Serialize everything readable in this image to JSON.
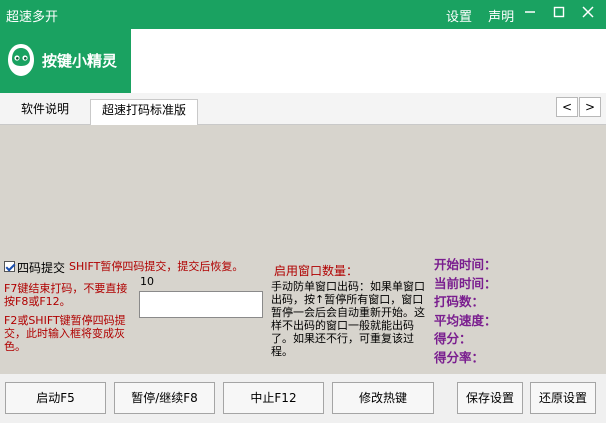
{
  "window": {
    "title": "超速多开",
    "links": [
      "设置",
      "声明"
    ],
    "controls": [
      "minimize-icon",
      "maximize-icon",
      "close-icon"
    ]
  },
  "header": {
    "app_name": "按键小精灵",
    "accent_color": "#1aa261"
  },
  "tabs": [
    {
      "label": "软件说明",
      "selected": false
    },
    {
      "label": "超速打码标准版",
      "selected": true
    }
  ],
  "tab_scroll": {
    "prev": "<",
    "next": ">"
  },
  "main": {
    "checkbox_label": "四码提交",
    "checkbox_checked": true,
    "shift_note": "SHIFT暂停四码提交，提交后恢复。",
    "f7_note": "F7键结束打码，不要直接按F8或F12。",
    "f2_note": "F2或SHIFT键暂停四码提交，此时输入框将变成灰色。",
    "count_label": "10",
    "input_value": "",
    "window_count_label": "启用窗口数量：",
    "manual_note": "手动防单窗口出码：如果单窗口出码，按↑暂停所有窗口，窗口暂停一会后会自动重新开始。这样不出码的窗口一般就能出码了。如果还不行，可重复该过程。"
  },
  "stats": {
    "start_time": "开始时间：",
    "current_time": "当前时间：",
    "code_count": "打码数：",
    "avg_speed": "平均速度：",
    "score": "得分：",
    "score_rate": "得分率："
  },
  "buttons": {
    "start": "启动F5",
    "pause": "暂停/继续F8",
    "stop": "中止F12",
    "hotkey": "修改热键",
    "save": "保存设置",
    "restore": "还原设置"
  }
}
